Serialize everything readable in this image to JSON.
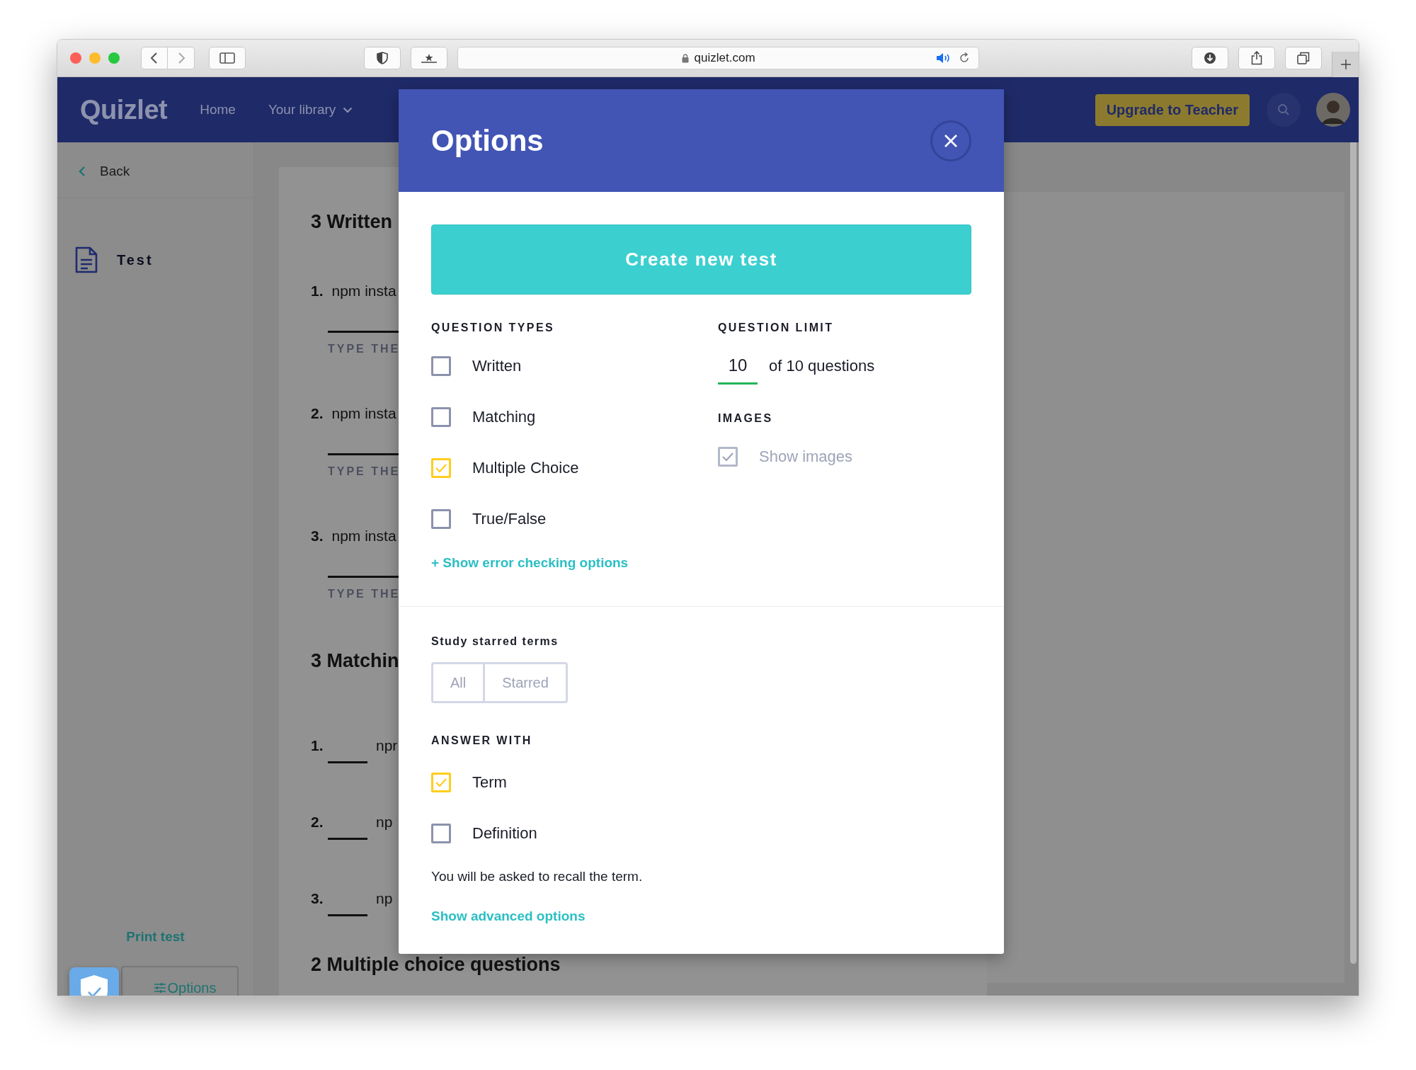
{
  "browser": {
    "url": "quizlet.com"
  },
  "nav": {
    "logo": "Quizlet",
    "links": [
      {
        "label": "Home",
        "dropdown": false
      },
      {
        "label": "Your library",
        "dropdown": true
      }
    ],
    "upgrade_button": "Upgrade to Teacher"
  },
  "sidebar": {
    "back": "Back",
    "items": [
      {
        "label": "Test",
        "selected": true
      }
    ],
    "print_link": "Print test",
    "options_button": "Options"
  },
  "test": {
    "sections": [
      {
        "kind": "written",
        "title": "3 Written",
        "questions": [
          {
            "number": "1.",
            "text": "npm insta",
            "hint": "TYPE THE"
          },
          {
            "number": "2.",
            "text": "npm insta",
            "hint": "TYPE THE"
          },
          {
            "number": "3.",
            "text": "npm insta",
            "hint": "TYPE THE"
          }
        ]
      },
      {
        "kind": "matching",
        "title": "3 Matchin",
        "questions": [
          {
            "number": "1.",
            "text": "npr"
          },
          {
            "number": "2.",
            "text": "np"
          },
          {
            "number": "3.",
            "text": "np"
          }
        ]
      },
      {
        "kind": "multiple",
        "title": "2 Multiple choice questions"
      }
    ]
  },
  "modal": {
    "title": "Options",
    "create_button": "Create new test",
    "question_types": {
      "label": "QUESTION TYPES",
      "options": [
        {
          "label": "Written",
          "checked": false
        },
        {
          "label": "Matching",
          "checked": false
        },
        {
          "label": "Multiple Choice",
          "checked": true
        },
        {
          "label": "True/False",
          "checked": false
        }
      ]
    },
    "error_link": "+ Show error checking options",
    "question_limit": {
      "label": "QUESTION LIMIT",
      "value": "10",
      "suffix": "of 10 questions"
    },
    "images": {
      "label": "IMAGES",
      "option": {
        "label": "Show images",
        "checked": true,
        "disabled": true
      }
    },
    "starred": {
      "label": "Study starred terms",
      "disabled": true,
      "options": [
        {
          "label": "All",
          "selected": false
        },
        {
          "label": "Starred",
          "selected": false
        }
      ]
    },
    "answer_with": {
      "label": "ANSWER WITH",
      "options": [
        {
          "label": "Term",
          "checked": true
        },
        {
          "label": "Definition",
          "checked": false
        }
      ]
    },
    "note": "You will be asked to recall the term.",
    "advanced_link": "Show advanced options"
  }
}
